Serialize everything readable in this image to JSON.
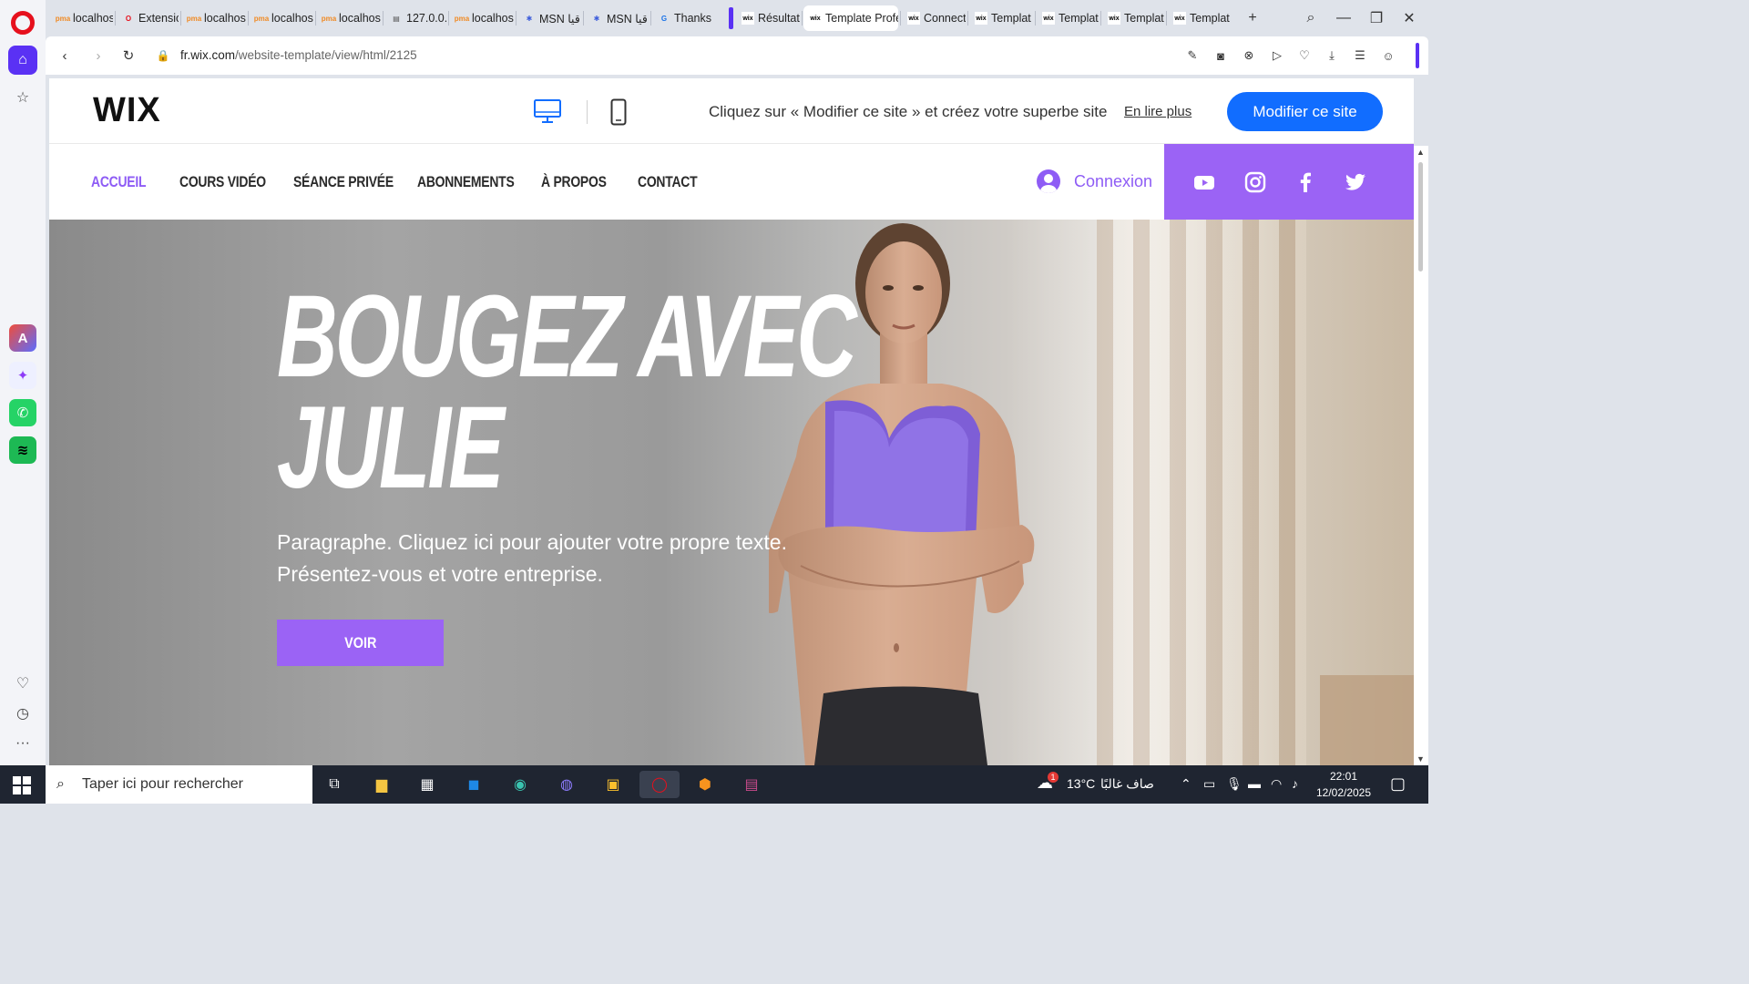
{
  "browser": {
    "tabs": [
      {
        "label": "localhos",
        "icon": "pma-icon"
      },
      {
        "label": "Extensio",
        "icon": "opera-icon"
      },
      {
        "label": "localhos",
        "icon": "pma-icon"
      },
      {
        "label": "localhos",
        "icon": "pma-icon"
      },
      {
        "label": "localhos",
        "icon": "pma-icon"
      },
      {
        "label": "127.0.0.",
        "icon": "file-icon"
      },
      {
        "label": "localhos",
        "icon": "pma-icon"
      },
      {
        "label": "MSN قيا",
        "icon": "msn-icon"
      },
      {
        "label": "MSN قيا",
        "icon": "msn-icon"
      },
      {
        "label": "Thanks",
        "icon": "g-icon"
      },
      {
        "label": "Résultat",
        "icon": "wix-icon"
      },
      {
        "label": "Template Profe",
        "icon": "wix-icon"
      },
      {
        "label": "Connect",
        "icon": "wix-icon"
      },
      {
        "label": "Templat",
        "icon": "wix-icon"
      },
      {
        "label": "Templat",
        "icon": "wix-icon"
      },
      {
        "label": "Templat",
        "icon": "wix-icon"
      },
      {
        "label": "Templat",
        "icon": "wix-icon"
      }
    ],
    "new_tab": "+",
    "url_host": "fr.wix.com",
    "url_path": "/website-template/view/html/2125"
  },
  "wix_bar": {
    "logo": "WIX",
    "message": "Cliquez sur « Modifier ce site » et créez votre superbe site",
    "read_more": "En lire plus",
    "edit_button": "Modifier ce site"
  },
  "site_nav": {
    "items": [
      "ACCUEIL",
      "COURS VIDÉO",
      "SÉANCE PRIVÉE",
      "ABONNEMENTS",
      "À PROPOS",
      "CONTACT"
    ],
    "active_index": 0,
    "login": "Connexion",
    "social": [
      "youtube-icon",
      "instagram-icon",
      "facebook-icon",
      "twitter-icon"
    ]
  },
  "hero": {
    "line1": "BOUGEZ AVEC",
    "line2": "JULIE",
    "paragraph": "Paragraphe. Cliquez ici pour ajouter votre propre texte. Présentez-vous et votre entreprise.",
    "button": "VOIR"
  },
  "taskbar": {
    "search_placeholder": "Taper ici pour rechercher",
    "weather_temp": "13°C",
    "weather_text": "صاف غالبًا",
    "time": "22:01",
    "date": "12/02/2025",
    "weather_badge": "1"
  },
  "colors": {
    "accent_purple": "#9b63f5",
    "nav_active": "#8e5cf5",
    "wix_blue": "#116dff",
    "opera_red": "#e6101d",
    "opera_violet": "#5a31f4"
  }
}
